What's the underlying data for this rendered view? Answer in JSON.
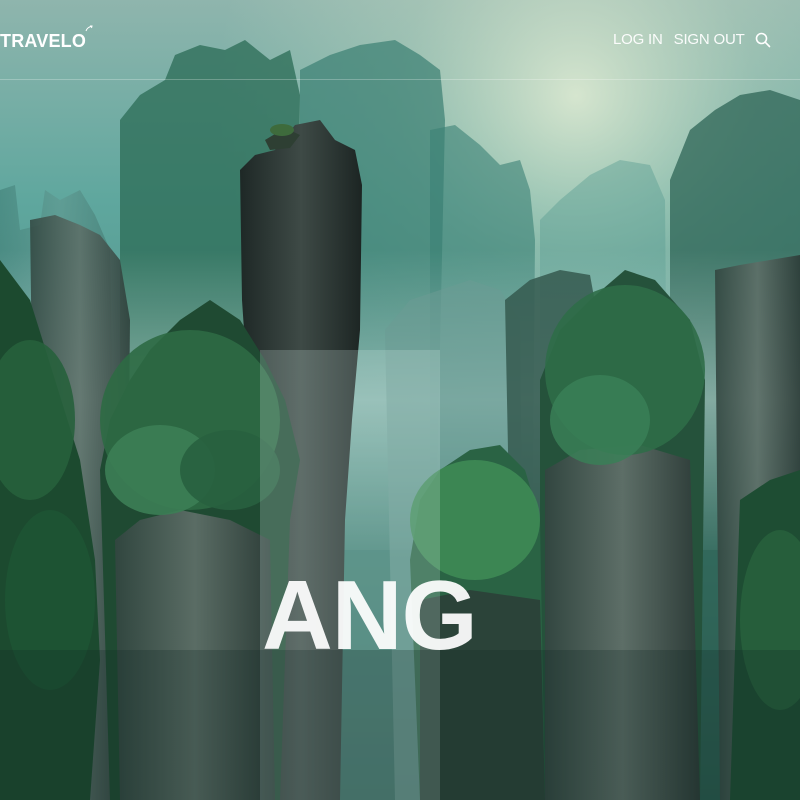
{
  "header": {
    "logo_text": "TRAVELO",
    "login_label": "LOG IN",
    "signout_label": "SIGN OUT",
    "search_icon": "search-icon"
  },
  "hero": {
    "title_fragment": "ANG",
    "image_description_icon": "landscape-image"
  },
  "colors": {
    "text": "#ffffff",
    "mist": "#9fd6cf",
    "rock": "#2f3a36",
    "foliage": "#2e6b3f"
  }
}
